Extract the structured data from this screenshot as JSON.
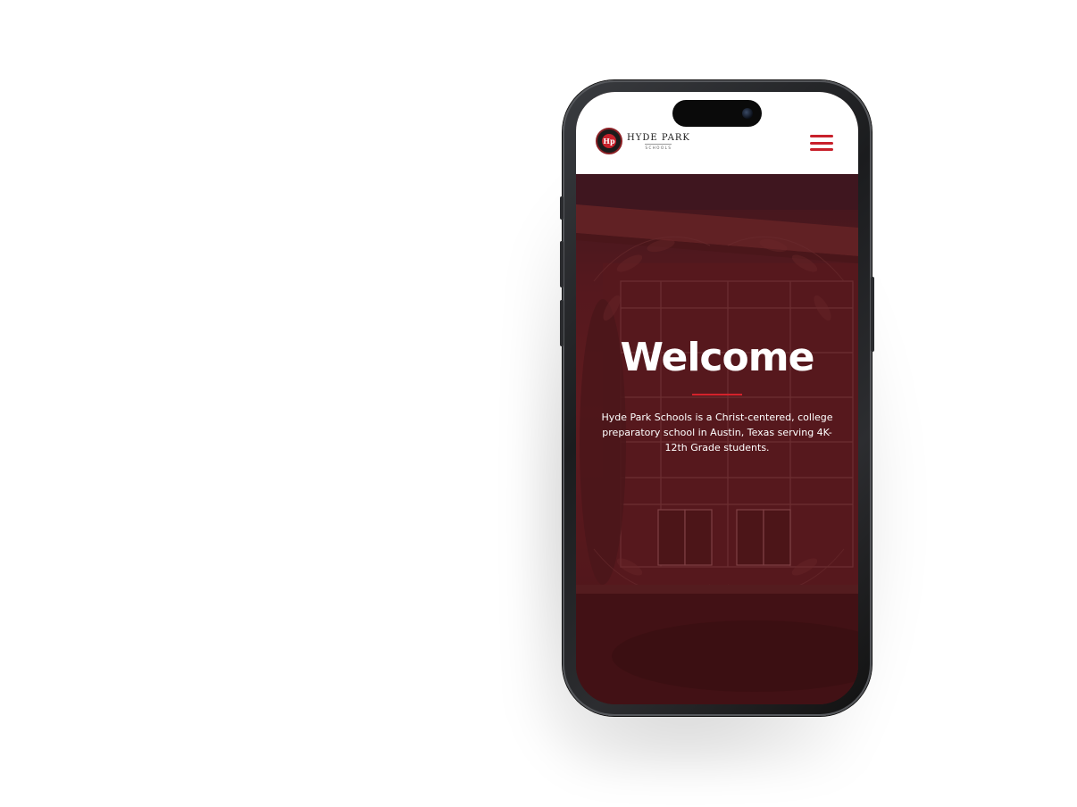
{
  "site": {
    "logo_monogram": "Hp",
    "logo_title": "HYDE PARK",
    "logo_subtitle": "SCHOOLS",
    "menu_icon": "hamburger-menu-icon"
  },
  "hero": {
    "title": "Welcome",
    "description": "Hyde Park Schools is a Christ-centered, college preparatory school in Austin, Texas serving 4K-12th Grade students."
  },
  "colors": {
    "accent_red": "#c8202b",
    "hero_overlay": "#5e1c20",
    "header_bg": "#ffffff"
  }
}
